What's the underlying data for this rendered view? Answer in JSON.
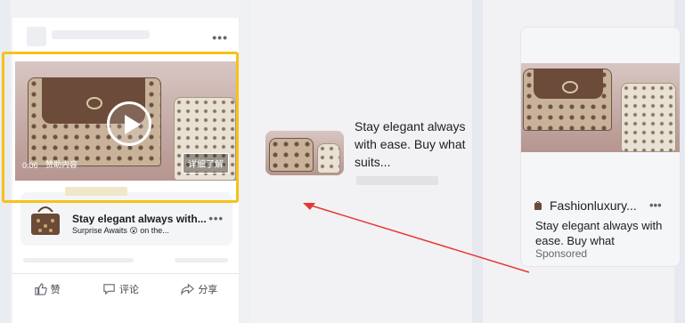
{
  "left_panel": {
    "menu_dots": "•••",
    "video": {
      "time": "0:06",
      "tag": "赞助内容",
      "cta": "详细了解"
    },
    "ad_card": {
      "title": "Stay elegant always with...",
      "subtitle": "Surprise Awaits 😮 on the...",
      "menu_dots": "•••"
    },
    "actions": {
      "like": "赞",
      "comment": "评论",
      "share": "分享"
    }
  },
  "middle_ad": {
    "text": "Stay elegant always with ease. Buy what suits..."
  },
  "right_ad": {
    "brand": "Fashionluxury...",
    "menu_dots": "•••",
    "description": "Stay elegant always with ease. Buy what",
    "sponsored": "Sponsored"
  },
  "colors": {
    "highlight": "#f6c21a",
    "arrow": "#e53935"
  },
  "icons": [
    "like-icon",
    "comment-icon",
    "share-icon",
    "play-icon",
    "bag-icon"
  ]
}
